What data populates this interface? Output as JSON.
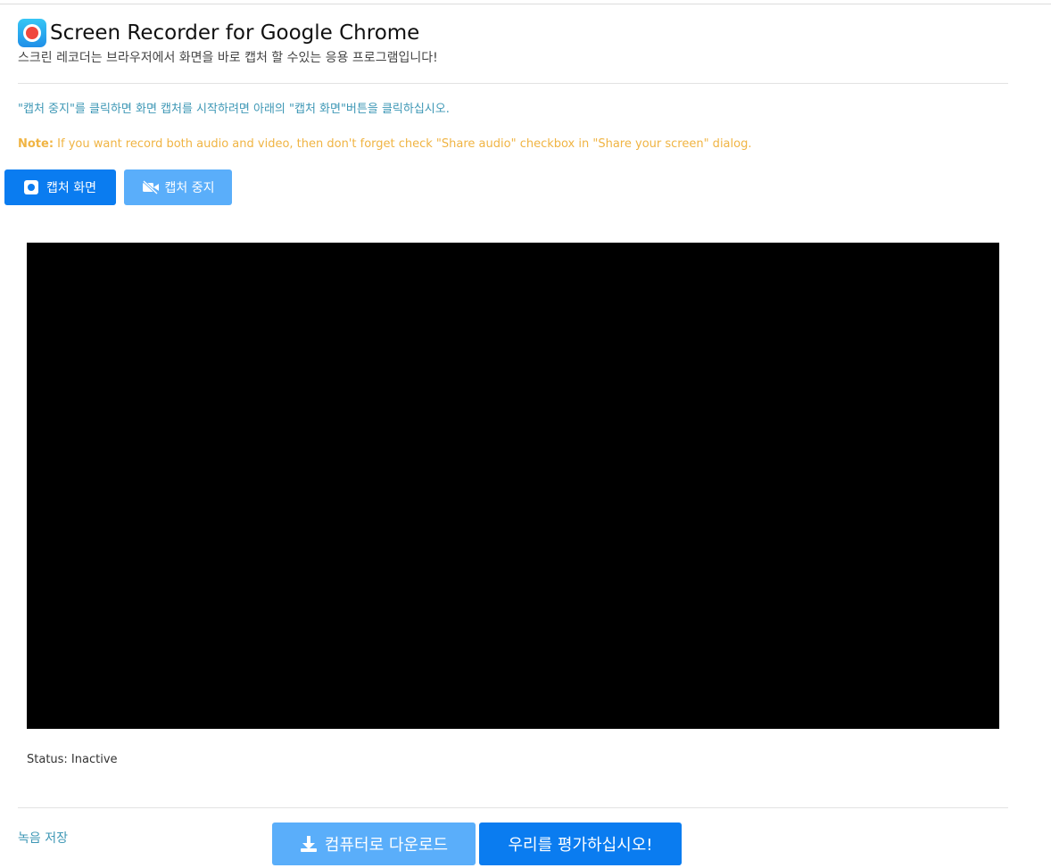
{
  "header": {
    "title": "Screen Recorder for Google Chrome",
    "subtitle": "스크린 레코더는 브라우저에서 화면을 바로 캡처 할 수있는 응용 프로그램입니다!",
    "icon": "record-app-icon"
  },
  "instructions": {
    "info": "\"캡처 중지\"를 클릭하면 화면 캡처를 시작하려면 아래의 \"캡처 화면\"버튼을 클릭하십시오.",
    "note_label": "Note:",
    "note": " If you want record both audio and video, then don't forget check \"Share audio\" checkbox in \"Share your screen\" dialog."
  },
  "controls": {
    "capture_label": "캡처 화면",
    "stop_label": "캡처 중지"
  },
  "status": {
    "text": "Status: Inactive"
  },
  "footer": {
    "save_link": "녹음 저장",
    "download_label": "컴퓨터로 다운로드",
    "rate_label": "우리를 평가하십시오!"
  },
  "colors": {
    "primary": "#0a7cf0",
    "primary_light": "#5aaefa",
    "info": "#3d97b5",
    "note": "#f0b443",
    "video_bg": "#000000"
  }
}
